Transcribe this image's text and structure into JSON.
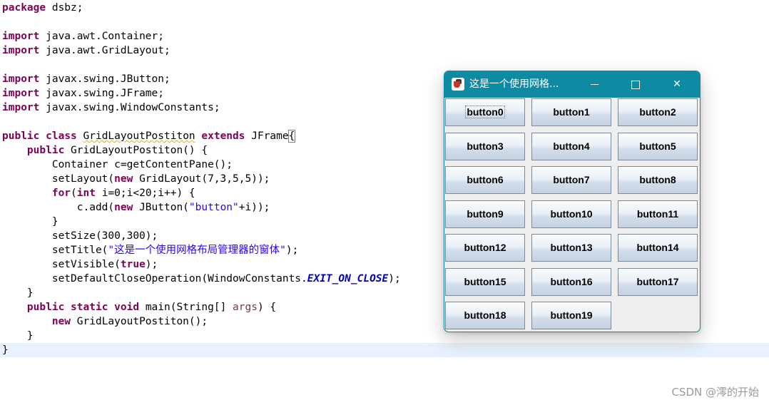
{
  "editor": {
    "lines": [
      "package dsbz;",
      "",
      "import java.awt.Container;",
      "import java.awt.GridLayout;",
      "",
      "import javax.swing.JButton;",
      "import javax.swing.JFrame;",
      "import javax.swing.WindowConstants;",
      "",
      "public class GridLayoutPostiton extends JFrame{",
      "    public GridLayoutPostiton() {",
      "        Container c=getContentPane();",
      "        setLayout(new GridLayout(7,3,5,5));",
      "        for(int i=0;i<20;i++) {",
      "            c.add(new JButton(\"button\"+i));",
      "        }",
      "        setSize(300,300);",
      "        setTitle(\"这是一个使用网格布局管理器的窗体\");",
      "        setVisible(true);",
      "        setDefaultCloseOperation(WindowConstants.EXIT_ON_CLOSE);",
      "    }",
      "    public static void main(String[] args) {",
      "        new GridLayoutPostiton();",
      "    }",
      "}"
    ]
  },
  "window": {
    "title": "这是一个使用网格...",
    "icon": "java-app-icon",
    "controls": {
      "minimize": "minimize-icon",
      "maximize": "maximize-icon",
      "close": "✕"
    },
    "accent_color": "#0e8aa3",
    "buttons": [
      "button0",
      "button1",
      "button2",
      "button3",
      "button4",
      "button5",
      "button6",
      "button7",
      "button8",
      "button9",
      "button10",
      "button11",
      "button12",
      "button13",
      "button14",
      "button15",
      "button16",
      "button17",
      "button18",
      "button19"
    ],
    "focused_button": "button0"
  },
  "watermark": "CSDN @澪的开始"
}
